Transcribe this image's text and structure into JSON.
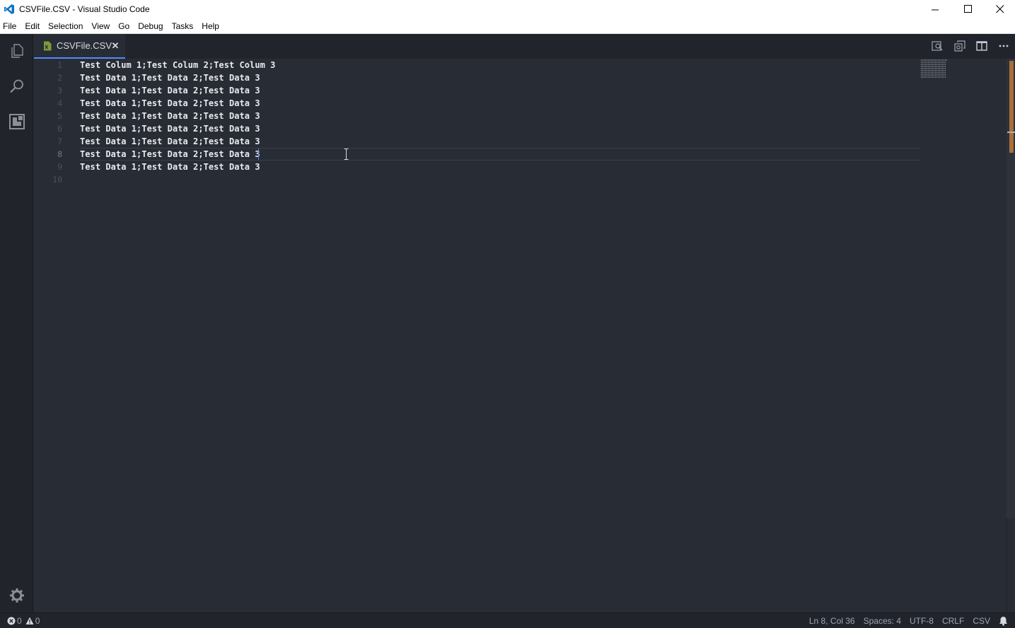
{
  "window": {
    "title": "CSVFile.CSV - Visual Studio Code"
  },
  "menu": [
    "File",
    "Edit",
    "Selection",
    "View",
    "Go",
    "Debug",
    "Tasks",
    "Help"
  ],
  "tab": {
    "label": "CSVFile.CSV",
    "close": "✕"
  },
  "editor": {
    "current_line": 8,
    "lines": [
      {
        "num": "1",
        "text": "Test Colum 1;Test Colum 2;Test Colum 3"
      },
      {
        "num": "2",
        "text": "Test Data 1;Test Data 2;Test Data 3"
      },
      {
        "num": "3",
        "text": "Test Data 1;Test Data 2;Test Data 3"
      },
      {
        "num": "4",
        "text": "Test Data 1;Test Data 2;Test Data 3"
      },
      {
        "num": "5",
        "text": "Test Data 1;Test Data 2;Test Data 3"
      },
      {
        "num": "6",
        "text": "Test Data 1;Test Data 2;Test Data 3"
      },
      {
        "num": "7",
        "text": "Test Data 1;Test Data 2;Test Data 3"
      },
      {
        "num": "8",
        "text": "Test Data 1;Test Data 2;Test Data 3"
      },
      {
        "num": "9",
        "text": "Test Data 1;Test Data 2;Test Data 3"
      },
      {
        "num": "10",
        "text": ""
      }
    ]
  },
  "status": {
    "errors": "0",
    "warnings": "0",
    "position": "Ln 8, Col 36",
    "spaces": "Spaces: 4",
    "encoding": "UTF-8",
    "eol": "CRLF",
    "language": "CSV"
  },
  "icons": {
    "explorer": "files-icon",
    "search": "search-icon",
    "extensions": "extensions-icon",
    "settings": "gear-icon",
    "open_preview": "open-preview-icon",
    "open_changes": "open-changes-icon",
    "split_editor": "split-editor-icon",
    "more_actions": "more-actions-icon",
    "notifications": "bell-icon"
  },
  "colors": {
    "accent": "#528bff",
    "editor_bg": "#282c34",
    "sidebar_bg": "#21252b"
  }
}
